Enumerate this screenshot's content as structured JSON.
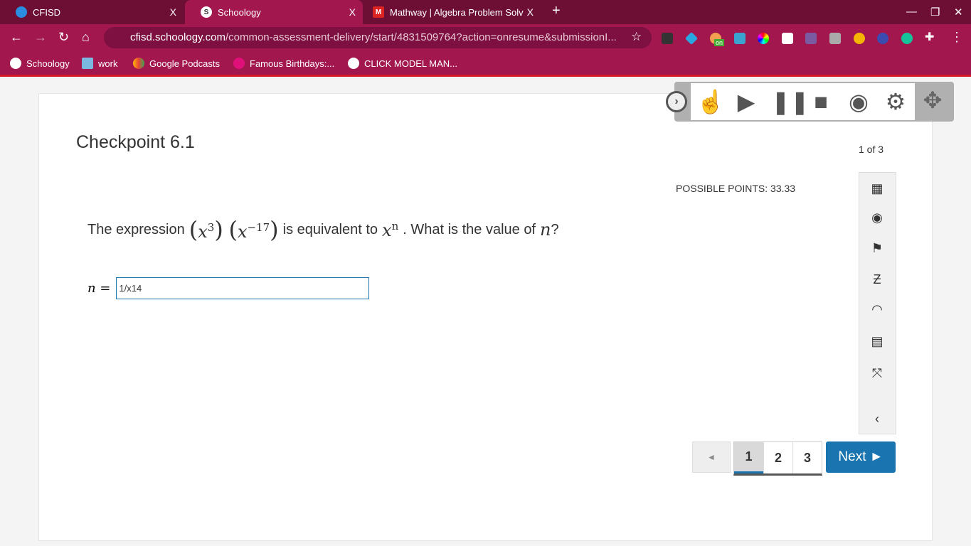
{
  "browser": {
    "tabs": [
      {
        "label": "CFISD",
        "close": "X"
      },
      {
        "label": "Schoology",
        "close": "X",
        "active": true
      },
      {
        "label": "Mathway | Algebra Problem Solv",
        "close": "X"
      }
    ],
    "new_tab": "+",
    "url_host": "cfisd.schoology.com",
    "url_path": "/common-assessment-delivery/start/4831509764?action=onresume&submissionI...",
    "bookmarks": [
      "Schoology",
      "work",
      "Google Podcasts",
      "Famous Birthdays:...",
      "CLICK MODEL MAN..."
    ],
    "extension_badge": "on"
  },
  "assessment": {
    "title": "Checkpoint 6.1",
    "question_count": "1 of 3",
    "possible_points": "POSSIBLE POINTS: 33.33",
    "question": {
      "prefix": "The expression",
      "exp1": "3",
      "exp2": "−17",
      "mid": "is equivalent to",
      "var": "x",
      "expn": "n",
      "suffix": ". What is the value of",
      "nvar": "n",
      "end": "?"
    },
    "answer_label": "n =",
    "answer_value": "1/x14"
  },
  "pager": {
    "prev": "◄",
    "pages": [
      "1",
      "2",
      "3"
    ],
    "current": 1,
    "next": "Next ►"
  },
  "colors": {
    "tabbar": "#6d0f35",
    "toolbar": "#a3174f",
    "primary": "#1a74b0"
  }
}
